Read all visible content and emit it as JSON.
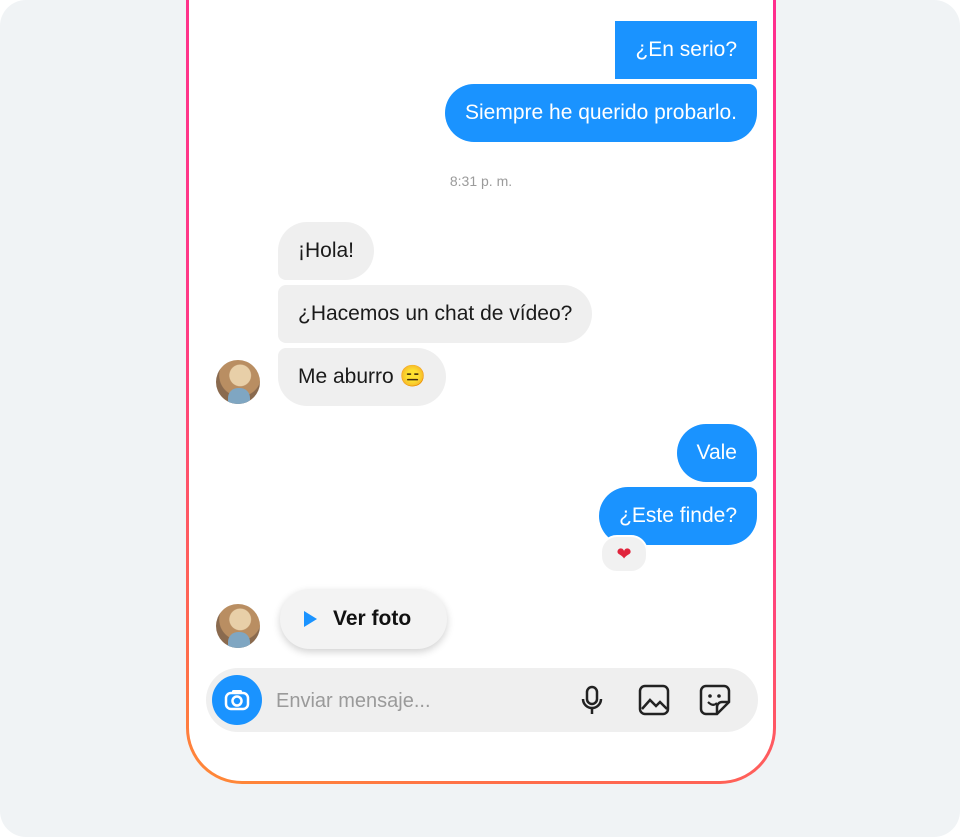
{
  "messages": [
    {
      "text": "¿En serio?",
      "direction": "outgoing"
    },
    {
      "text": "Siempre he querido probarlo.",
      "direction": "outgoing"
    },
    {
      "text": "¡Hola!",
      "direction": "incoming"
    },
    {
      "text": "¿Hacemos un chat de vídeo?",
      "direction": "incoming"
    },
    {
      "text": "Me aburro 😑",
      "direction": "incoming"
    },
    {
      "text": "Vale",
      "direction": "outgoing"
    },
    {
      "text": "¿Este finde?",
      "direction": "outgoing"
    }
  ],
  "timestamp": "8:31 p. m.",
  "reaction": {
    "emoji": "❤",
    "icon": "heart-icon"
  },
  "view_photo": {
    "label": "Ver foto",
    "icon": "play-icon"
  },
  "composer": {
    "placeholder": "Enviar mensaje...",
    "value": "",
    "icons": [
      "camera-icon",
      "microphone-icon",
      "gallery-icon",
      "sticker-icon"
    ]
  },
  "colors": {
    "outgoing_bubble": "#1a93ff",
    "incoming_bubble": "#efefef",
    "frame_gradient_top": "#ff2c8e",
    "frame_gradient_bottom": "#ff8b35",
    "background": "#f0f3f5"
  }
}
